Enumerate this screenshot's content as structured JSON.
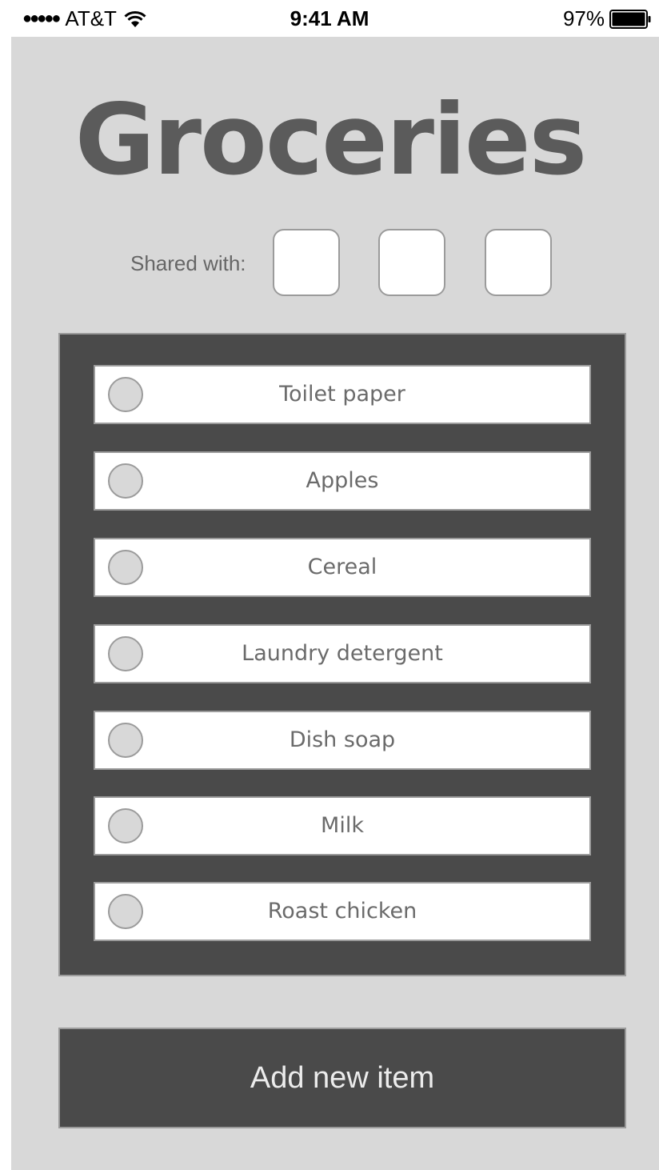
{
  "status_bar": {
    "signal": "●●●●●",
    "carrier": "AT&T",
    "time": "9:41 AM",
    "battery": "97%"
  },
  "page": {
    "title": "Groceries",
    "shared_label": "Shared with:"
  },
  "list": {
    "items": [
      {
        "label": "Toilet paper"
      },
      {
        "label": "Apples"
      },
      {
        "label": "Cereal"
      },
      {
        "label": "Laundry detergent"
      },
      {
        "label": "Dish soap"
      },
      {
        "label": "Milk"
      },
      {
        "label": "Roast chicken"
      }
    ]
  },
  "actions": {
    "add_label": "Add new item"
  },
  "colors": {
    "background": "#d8d8d8",
    "panel": "#4a4a4a",
    "title": "#5b5b5b",
    "border": "#9b9b9b"
  }
}
